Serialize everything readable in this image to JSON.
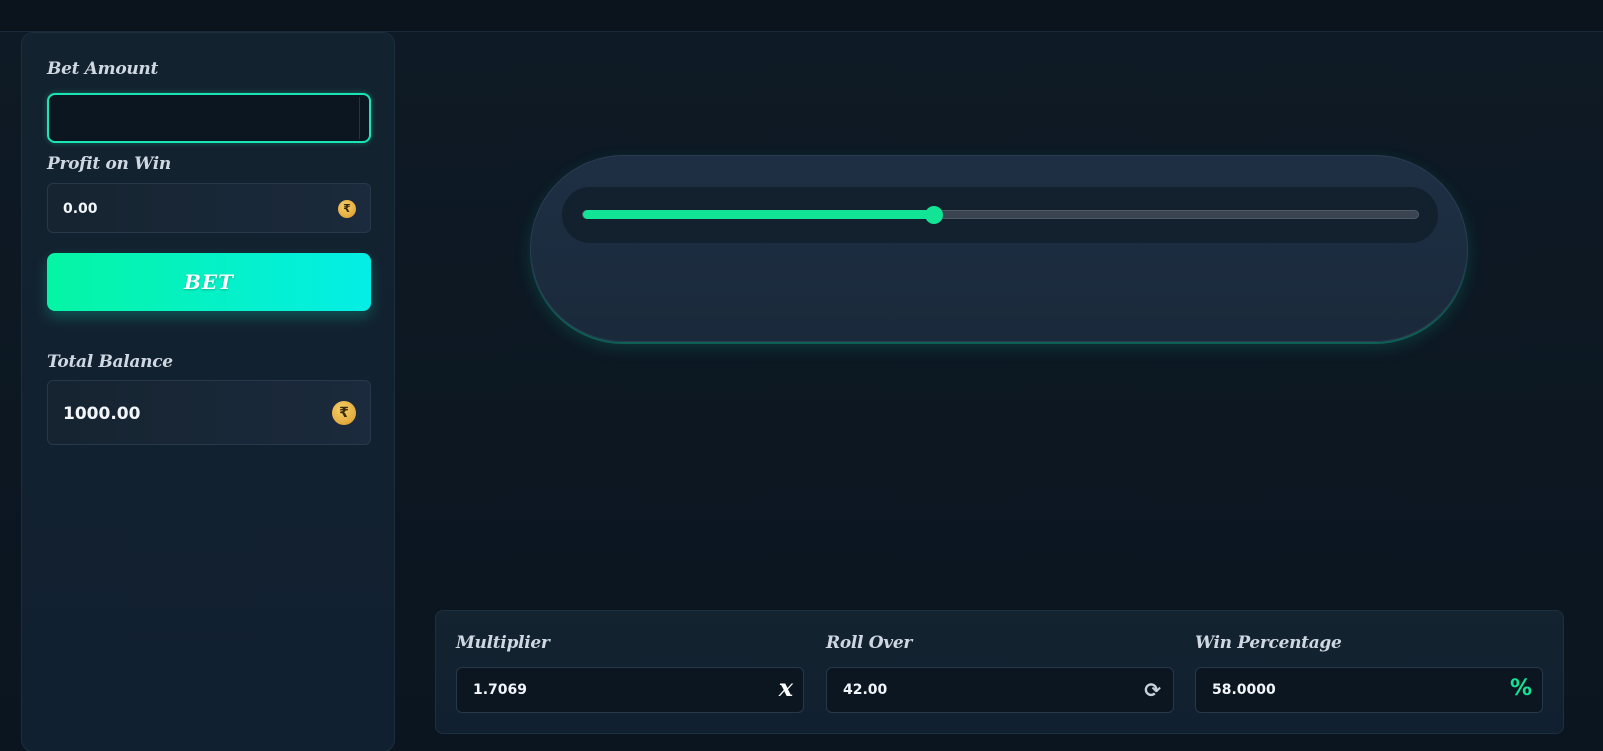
{
  "sidebar": {
    "bet_amount": {
      "label": "Bet Amount",
      "value": "",
      "placeholder": ""
    },
    "profit_on_win": {
      "label": "Profit on Win",
      "value": "0.00",
      "currency_symbol": "₹"
    },
    "bet_button": {
      "label": "BET"
    },
    "total_balance": {
      "label": "Total Balance",
      "value": "1000.00",
      "currency_symbol": "₹"
    }
  },
  "slider": {
    "value_fraction": 0.42,
    "fill_color": "#12e495",
    "track_color": "#3a4450"
  },
  "stats": {
    "multiplier": {
      "label": "Multiplier",
      "value": "1.7069",
      "icon_glyph": "x",
      "icon_name": "multiplier-x-icon"
    },
    "roll_over": {
      "label": "Roll Over",
      "value": "42.00",
      "icon_glyph": "⟳",
      "icon_name": "refresh-icon"
    },
    "win_percentage": {
      "label": "Win Percentage",
      "value": "58.0000",
      "icon_glyph": "%",
      "icon_name": "percent-icon"
    }
  },
  "colors": {
    "accent": "#12e495",
    "accent_cyan": "#04eee6",
    "coin": "#e2aa3c",
    "background": "#0c1620"
  }
}
